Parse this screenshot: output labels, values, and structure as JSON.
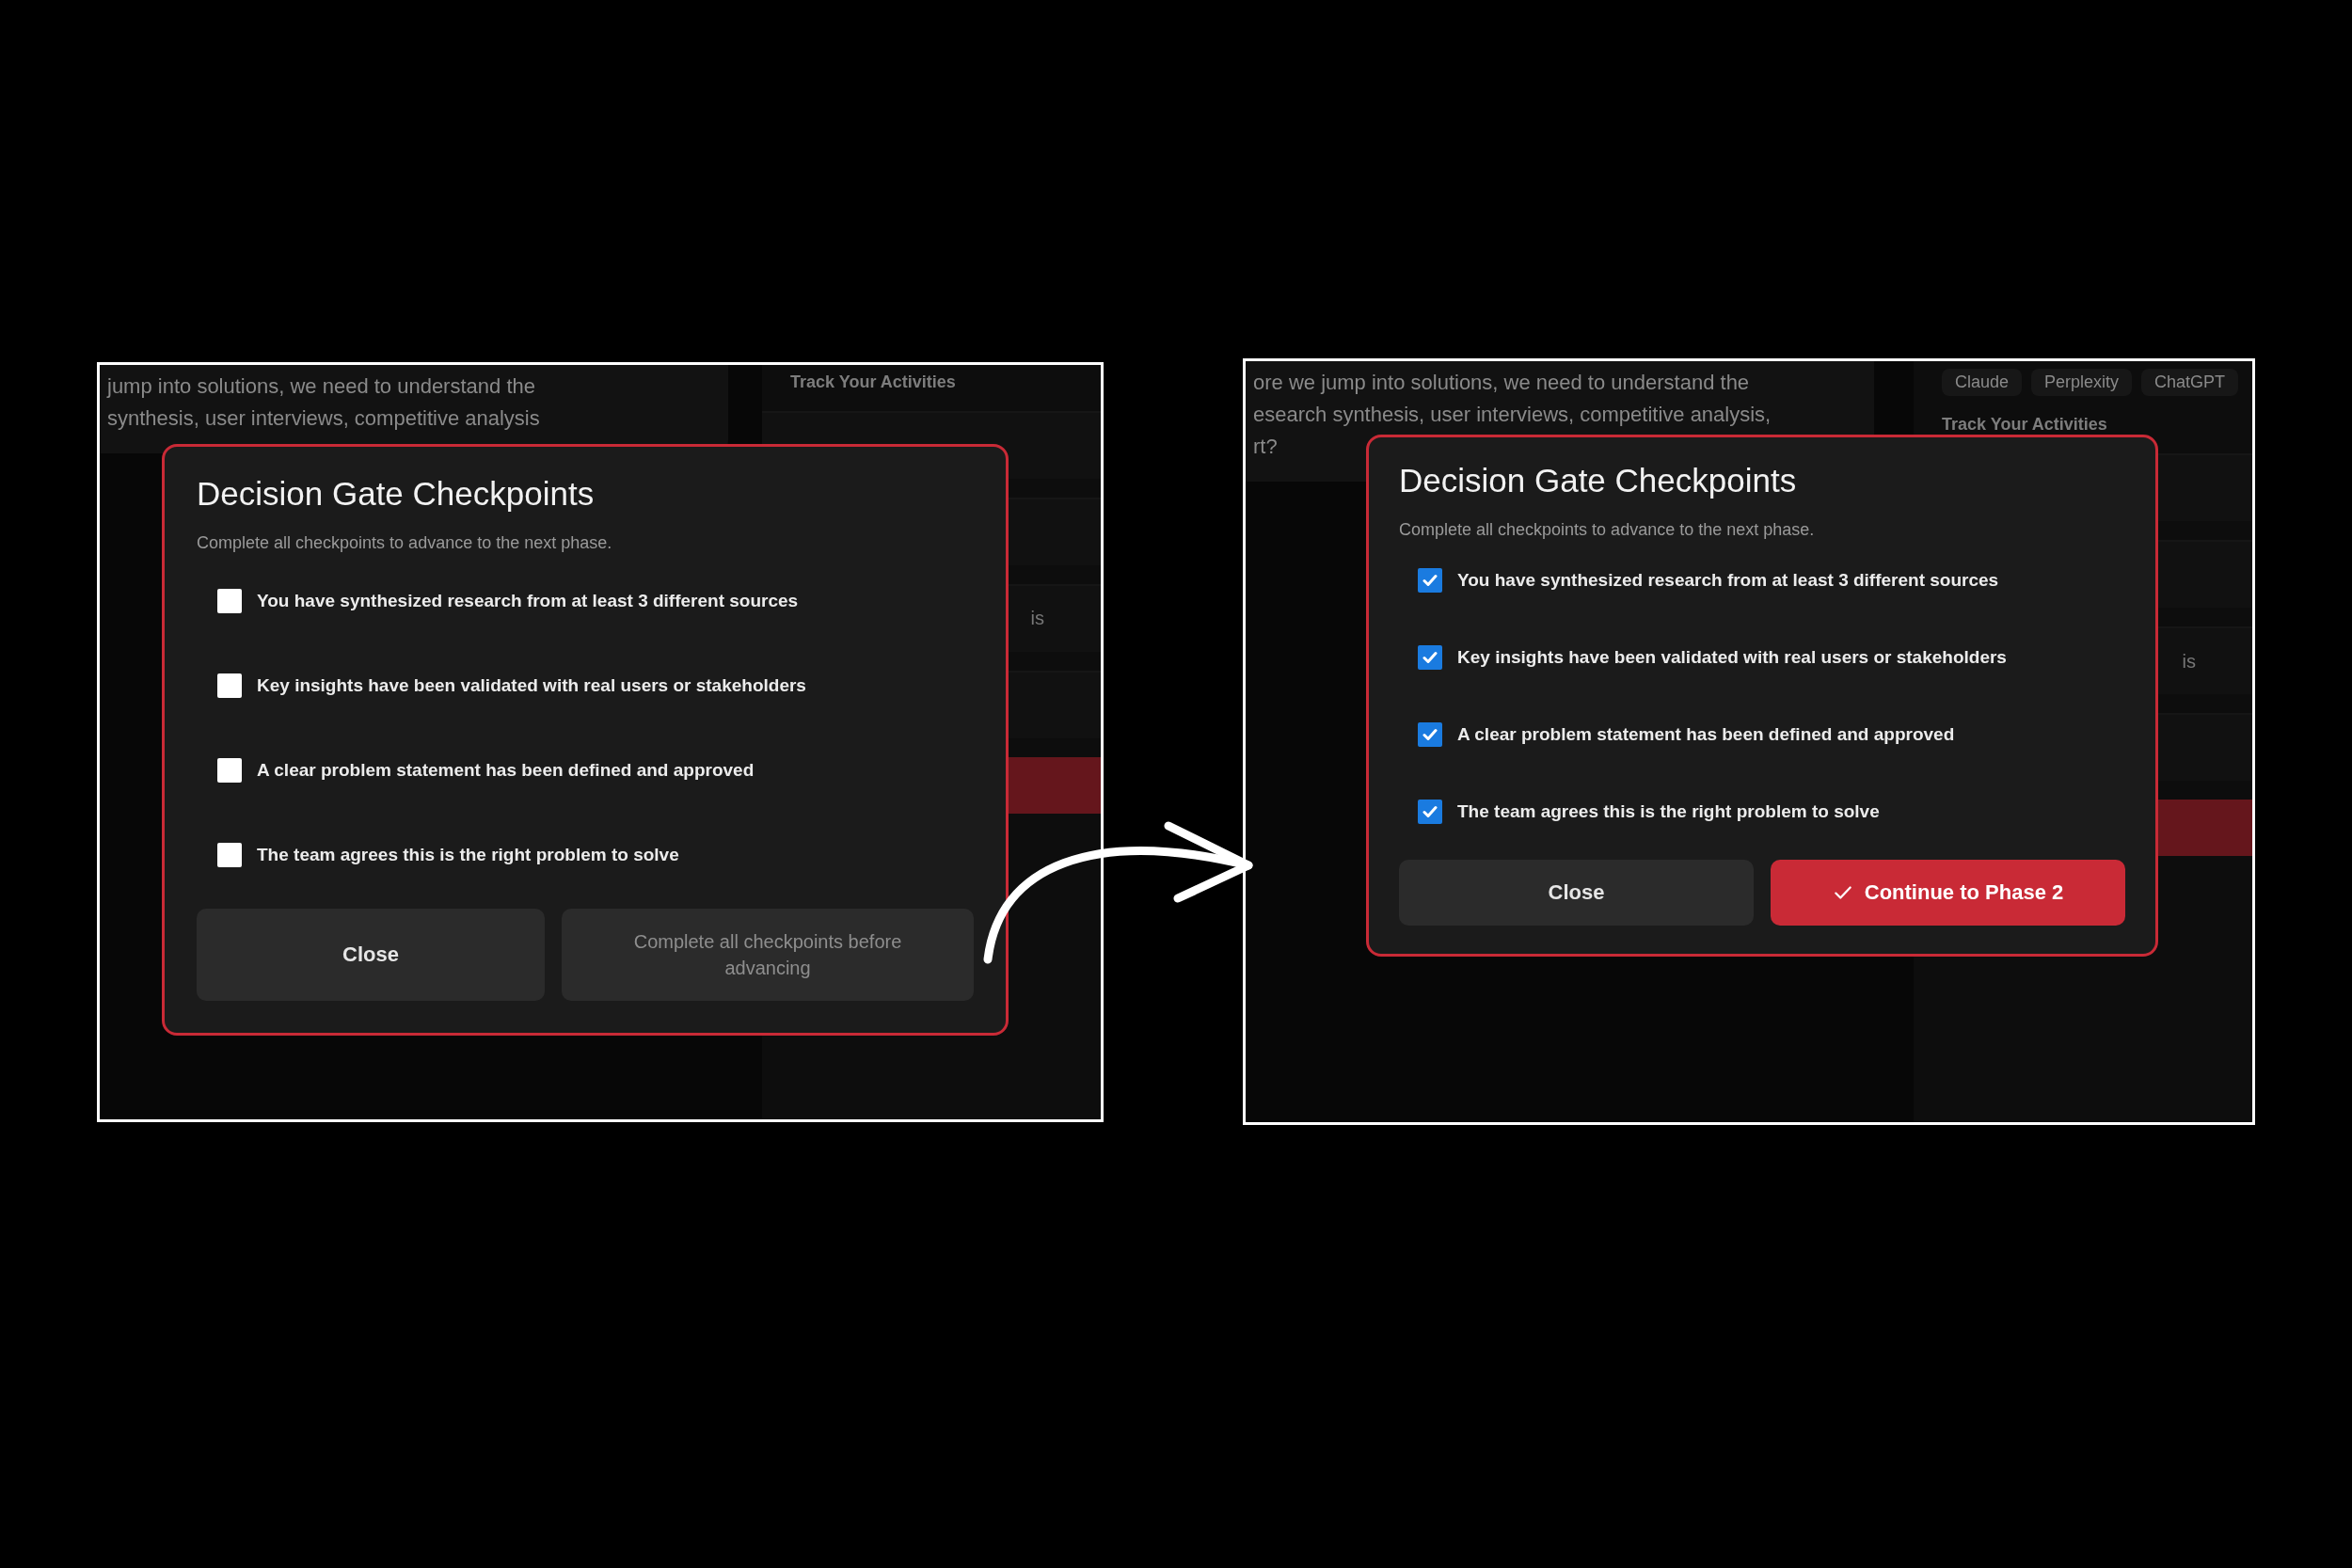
{
  "panels": [
    {
      "background": {
        "message_lines": [
          "jump into solutions, we need to understand the",
          "synthesis, user interviews, competitive analysis"
        ],
        "sidebar_heading": "Track Your Activities",
        "sidebar_fragment": "is"
      },
      "dialog": {
        "title": "Decision Gate Checkpoints",
        "subtitle": "Complete all checkpoints to advance to the next phase.",
        "checkpoints": [
          {
            "label": "You have synthesized research from at least 3 different sources",
            "checked": false
          },
          {
            "label": "Key insights have been validated with real users or stakeholders",
            "checked": false
          },
          {
            "label": "A clear problem statement has been defined and approved",
            "checked": false
          },
          {
            "label": "The team agrees this is the right problem to solve",
            "checked": false
          }
        ],
        "buttons": [
          {
            "label": "Close",
            "kind": "secondary"
          },
          {
            "label": "Complete all checkpoints before advancing",
            "kind": "disabled"
          }
        ]
      }
    },
    {
      "background": {
        "message_lines": [
          "ore we jump into solutions, we need to understand the",
          "esearch synthesis, user interviews, competitive analysis,",
          "rt?"
        ],
        "chips": [
          "Claude",
          "Perplexity",
          "ChatGPT"
        ],
        "sidebar_heading": "Track Your Activities",
        "sidebar_fragment": "is"
      },
      "dialog": {
        "title": "Decision Gate Checkpoints",
        "subtitle": "Complete all checkpoints to advance to the next phase.",
        "checkpoints": [
          {
            "label": "You have synthesized research from at least 3 different sources",
            "checked": true
          },
          {
            "label": "Key insights have been validated with real users or stakeholders",
            "checked": true
          },
          {
            "label": "A clear problem statement has been defined and approved",
            "checked": true
          },
          {
            "label": "The team agrees this is the right problem to solve",
            "checked": true
          }
        ],
        "buttons": [
          {
            "label": "Close",
            "kind": "secondary"
          },
          {
            "label": "Continue to Phase 2",
            "kind": "primary"
          }
        ]
      }
    }
  ]
}
